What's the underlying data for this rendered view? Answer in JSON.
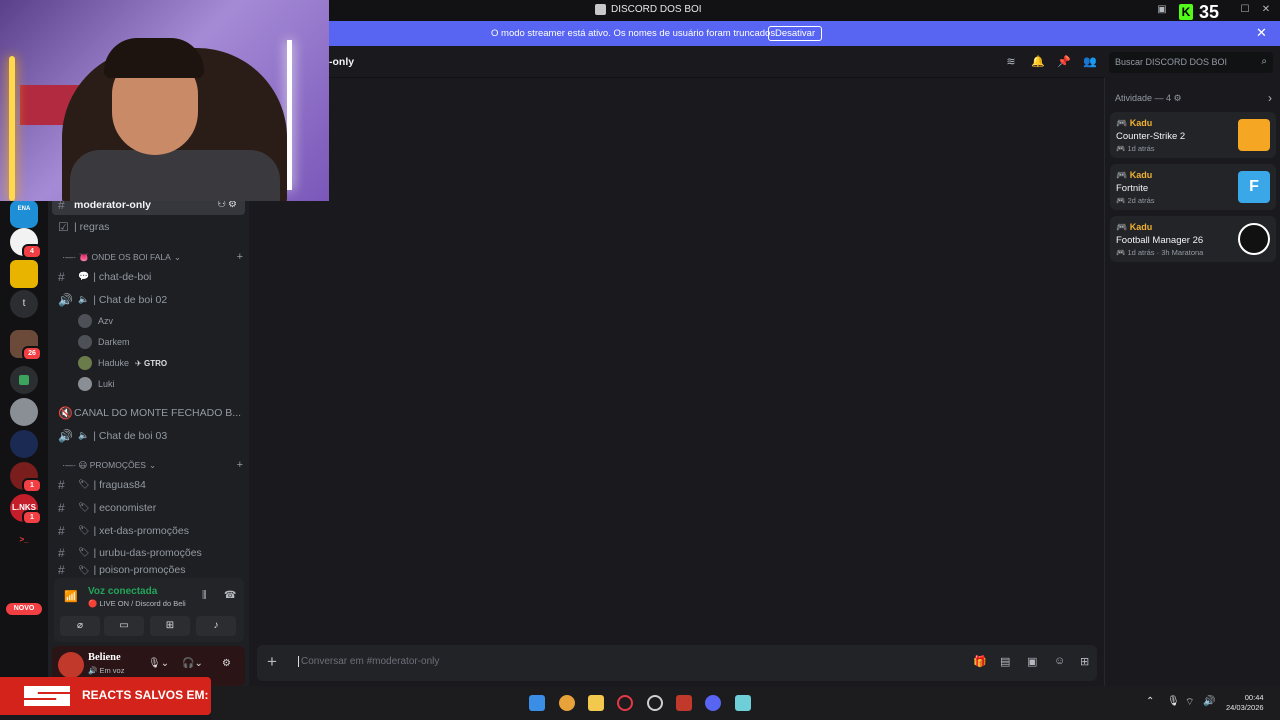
{
  "window": {
    "title": "DISCORD DOS BOI"
  },
  "kick": {
    "viewer_count": "35"
  },
  "banner": {
    "text": "O modo streamer está ativo. Os nomes de usuário foram truncados.",
    "button": "Desativar",
    "color": "#5865f2"
  },
  "rail": {
    "badges": [
      "4",
      "26",
      "1",
      "1"
    ],
    "server_labels": [
      "ENA",
      "t",
      "L.NKS"
    ],
    "novo": "NOVO"
  },
  "sidebar": {
    "active_channel": "moderator-only",
    "rules_channel": "| regras",
    "category1": "·—·  👅 ONDE OS BOI FALA",
    "chat_channel": "| chat-de-boi",
    "voice1": "|  Chat de boi 02",
    "voice_users": [
      "Azv",
      "Darkem",
      "Haduke",
      "Luki"
    ],
    "haduke_tag": "GTRO",
    "voice2": "CANAL DO MONTE FECHADO B...",
    "voice3": "|  Chat de boi 03",
    "category2": "·—·  😃 PROMOÇÕES",
    "promo_channels": [
      "| fraguas84",
      "| economister",
      "| xet-das-promoções",
      "| urubu-das-promoções",
      "| poison-promoções"
    ]
  },
  "voice_panel": {
    "status": "Voz conectada",
    "sub": "🔴 LIVE ON / Discord do Beli",
    "status_color": "#23a559"
  },
  "user_panel": {
    "name": "Beliene",
    "status": "Em voz"
  },
  "chat": {
    "header": "-only",
    "placeholder": "Conversar em #moderator-only"
  },
  "search": {
    "placeholder": "Buscar DISCORD DOS BOI"
  },
  "activity": {
    "header": "Atividade — 4",
    "cards": [
      {
        "user": "Kadu",
        "game": "Counter-Strike 2",
        "time": "1d atrás"
      },
      {
        "user": "Kadu",
        "game": "Fortnite",
        "time": "2d atrás"
      },
      {
        "user": "Kadu",
        "game": "Football Manager 26",
        "time": "1d atrás",
        "extra": "3h Maratona"
      }
    ]
  },
  "overlay": {
    "text": "REACTS SALVOS EM:"
  },
  "taskbar": {
    "time": "00:44",
    "date": "24/03/2026"
  }
}
